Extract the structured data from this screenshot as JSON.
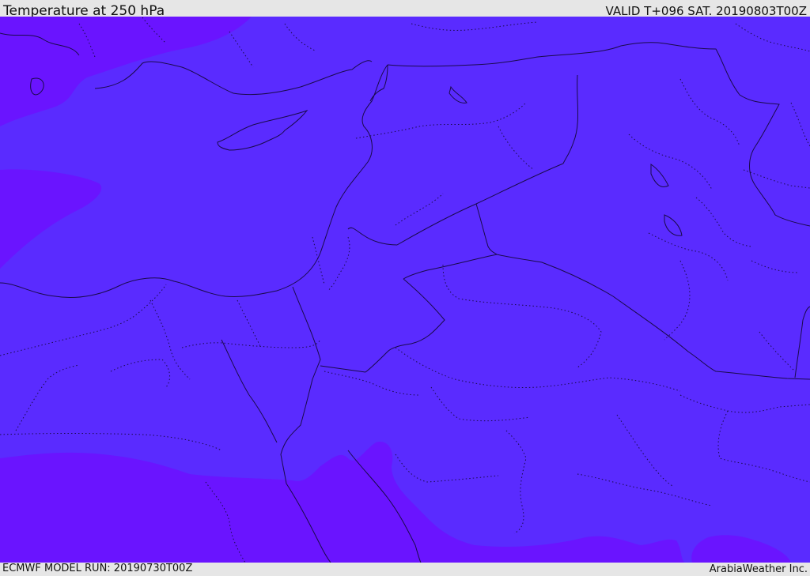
{
  "header": {
    "title": "Temperature at 250 hPa",
    "valid_time": "VALID T+096 SAT. 20190803T00Z"
  },
  "footer": {
    "model_run": "ECMWF MODEL RUN: 20190730T00Z",
    "credit": "ArabiaWeather Inc."
  },
  "map": {
    "colors": {
      "main_field": "#5a2bff",
      "colder_field": "#6a14ff",
      "boundary_solid": "#1a0a4a",
      "boundary_dotted": "#1a0a4a"
    }
  }
}
